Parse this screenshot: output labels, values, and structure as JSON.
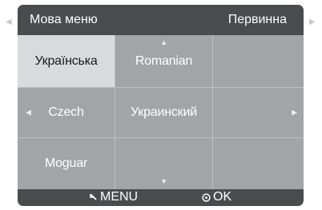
{
  "side_arrows": {
    "left": "◀",
    "right": "▶"
  },
  "header": {
    "title": "Мова меню",
    "value": "Первинна"
  },
  "grid": {
    "cells": [
      {
        "label": "Українська"
      },
      {
        "label": "Romanian"
      },
      {
        "label": ""
      },
      {
        "label": "Czech"
      },
      {
        "label": "Украинский"
      },
      {
        "label": ""
      },
      {
        "label": "Moguar"
      },
      {
        "label": ""
      },
      {
        "label": ""
      }
    ],
    "arrows": {
      "up": "▲",
      "down": "▼",
      "left": "◀",
      "right": "▶"
    }
  },
  "footer": {
    "menu_label": "MENU",
    "ok_label": "OK"
  },
  "colors": {
    "panel": "#4a4b4d",
    "cell": "#a2a4a6",
    "selected_cell": "#d9dadb",
    "text": "#ffffff"
  }
}
